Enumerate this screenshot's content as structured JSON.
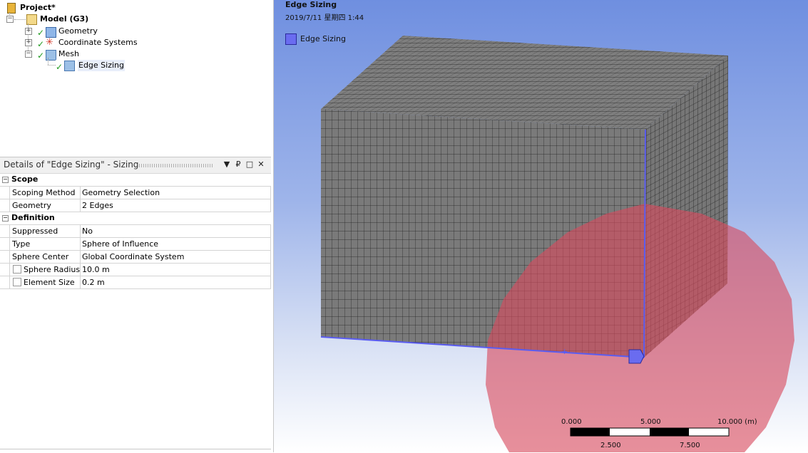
{
  "tree": {
    "project": "Project*",
    "model": "Model (G3)",
    "geometry": "Geometry",
    "coord_systems": "Coordinate Systems",
    "mesh": "Mesh",
    "edge_sizing": "Edge Sizing"
  },
  "details": {
    "title": "Details of \"Edge Sizing\" - Sizing",
    "header_buttons": [
      "▼",
      "₽",
      "□",
      "✕"
    ],
    "sections": [
      {
        "name": "Scope",
        "rows": [
          {
            "label": "Scoping Method",
            "value": "Geometry Selection",
            "checkbox": false
          },
          {
            "label": "Geometry",
            "value": "2 Edges",
            "checkbox": false
          }
        ]
      },
      {
        "name": "Definition",
        "rows": [
          {
            "label": "Suppressed",
            "value": "No",
            "checkbox": false
          },
          {
            "label": "Type",
            "value": "Sphere of Influence",
            "checkbox": false
          },
          {
            "label": "Sphere Center",
            "value": "Global Coordinate System",
            "checkbox": false
          },
          {
            "label": "Sphere Radius",
            "value": "10.0 m",
            "checkbox": true
          },
          {
            "label": "Element Size",
            "value": "0.2 m",
            "checkbox": true
          }
        ]
      }
    ]
  },
  "viewport": {
    "title": "Edge Sizing",
    "date": "2019/7/11 星期四 1:44",
    "legend_label": "Edge Sizing",
    "legend_color": "#6a6cf0",
    "scale": {
      "top_labels": [
        "0.000",
        "5.000",
        "10.000 (m)"
      ],
      "bottom_labels": [
        "2.500",
        "7.500"
      ]
    }
  },
  "colors": {
    "mesh_face": "#7a7a7a",
    "mesh_line": "#1a1a1a",
    "sphere": "#d85060",
    "highlight": "#6a6cf0"
  }
}
